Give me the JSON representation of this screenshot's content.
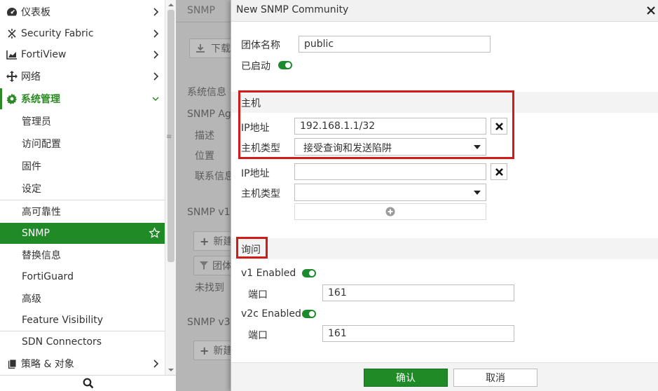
{
  "sidebar": {
    "items": [
      {
        "label": "仪表板"
      },
      {
        "label": "Security Fabric"
      },
      {
        "label": "FortiView"
      },
      {
        "label": "网络"
      },
      {
        "label": "系统管理"
      },
      {
        "label": "管理员"
      },
      {
        "label": "访问配置"
      },
      {
        "label": "固件"
      },
      {
        "label": "设定"
      },
      {
        "label": "高可靠性"
      },
      {
        "label": "SNMP"
      },
      {
        "label": "替换信息"
      },
      {
        "label": "FortiGuard"
      },
      {
        "label": "高级"
      },
      {
        "label": "Feature Visibility"
      },
      {
        "label": "SDN Connectors"
      },
      {
        "label": "策略 & 对象"
      }
    ]
  },
  "background": {
    "title": "SNMP",
    "download_btn": "下载",
    "sys_info": "系统信息",
    "agent": "SNMP Ag",
    "desc": "描述",
    "location": "位置",
    "contact": "联系信息",
    "v1_section": "SNMP v1",
    "new_btn": "新建",
    "filter_col": "团体",
    "not_found": "未找到",
    "v3_section": "SNMP v3",
    "new_btn2": "新建"
  },
  "dialog": {
    "title": "New SNMP Community",
    "community_name_label": "团体名称",
    "community_name_value": "public",
    "enabled_label": "已启动",
    "hosts_section": "主机",
    "host1": {
      "ip_label": "IP地址",
      "ip_value": "192.168.1.1/32",
      "type_label": "主机类型",
      "type_value": "接受查询和发送陷阱"
    },
    "host2": {
      "ip_label": "IP地址",
      "ip_value": "",
      "type_label": "主机类型",
      "type_value": ""
    },
    "query_section": "询问",
    "v1_enabled_label": "v1 Enabled",
    "v1_port_label": "端口",
    "v1_port_value": "161",
    "v2c_enabled_label": "v2c Enabled",
    "v2c_port_label": "端口",
    "v2c_port_value": "161",
    "ok_label": "确认",
    "cancel_label": "取消"
  },
  "colors": {
    "accent_green": "#1f8a26",
    "highlight_red": "#d11a1a"
  },
  "icons": {
    "dashboard": "dashboard-icon",
    "fabric": "security-fabric-icon",
    "fortiview": "chart-icon",
    "network": "network-icon",
    "system": "gear-icon",
    "policy": "policy-icon",
    "search": "search-icon",
    "star": "star-icon",
    "close": "close-icon",
    "remove": "remove-icon",
    "add": "add-icon"
  }
}
